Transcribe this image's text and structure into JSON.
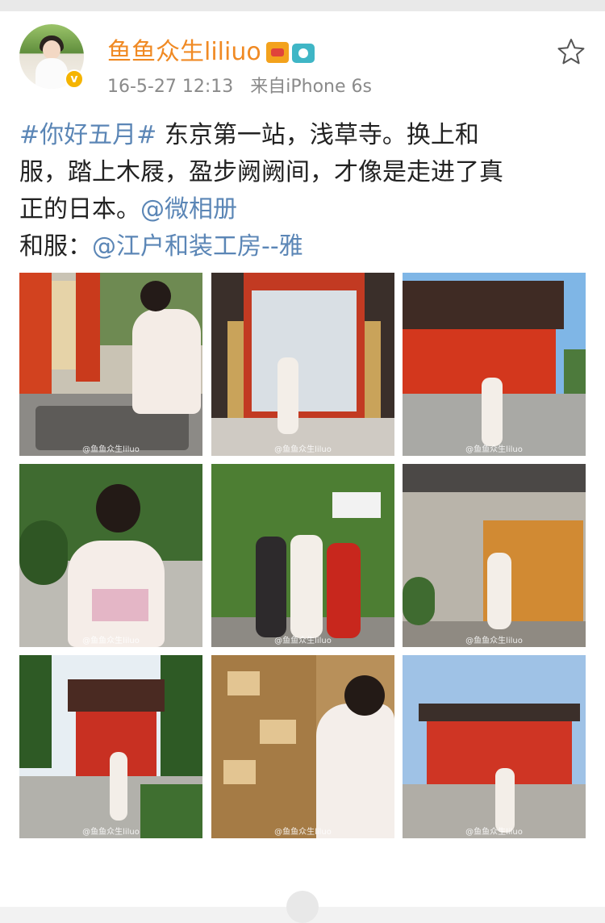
{
  "post": {
    "username": "鱼鱼众生liliuo",
    "time": "16-5-27 12:13",
    "source": "来自iPhone 6s",
    "text_lines": [
      {
        "parts": [
          {
            "t": "#你好五月#",
            "link": true
          },
          {
            "t": " 东京第一站，浅草寺。换上和",
            "link": false
          }
        ]
      },
      {
        "parts": [
          {
            "t": "服，踏上木屐，盈步阙阙间，才像是走进了真",
            "link": false
          }
        ]
      },
      {
        "parts": [
          {
            "t": "正的日本。",
            "link": false
          },
          {
            "t": "@微相册",
            "link": true
          }
        ]
      },
      {
        "parts": [
          {
            "t": "和服：",
            "link": false
          },
          {
            "t": "@江户和装工房--雅",
            "link": true
          }
        ]
      }
    ],
    "watermark": "@鱼鱼众生liluo",
    "colors": {
      "username": "#f08a24",
      "link": "#5b86b6",
      "meta": "#8a8a8a"
    },
    "icons": [
      "vip-crown-icon",
      "camera-icon",
      "star-icon",
      "verified-badge-icon"
    ]
  }
}
